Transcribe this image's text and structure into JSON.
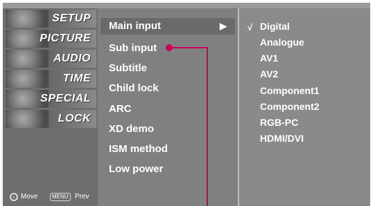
{
  "sidebar": {
    "items": [
      "SETUP",
      "PICTURE",
      "AUDIO",
      "TIME",
      "SPECIAL",
      "LOCK"
    ],
    "hint_move": "Move",
    "hint_menu_key": "MENU",
    "hint_prev": "Prev"
  },
  "menu": {
    "items": [
      "Main input",
      "Sub input",
      "Subtitle",
      "Child lock",
      "ARC",
      "XD demo",
      "ISM method",
      "Low power"
    ],
    "selected_arrow": "▶"
  },
  "submenu": {
    "check": "√",
    "items": [
      "Digital",
      "Analogue",
      "AV1",
      "AV2",
      "Component1",
      "Component2",
      "RGB-PC",
      "HDMI/DVI"
    ]
  },
  "colors": {
    "callout": "#c8005a"
  }
}
